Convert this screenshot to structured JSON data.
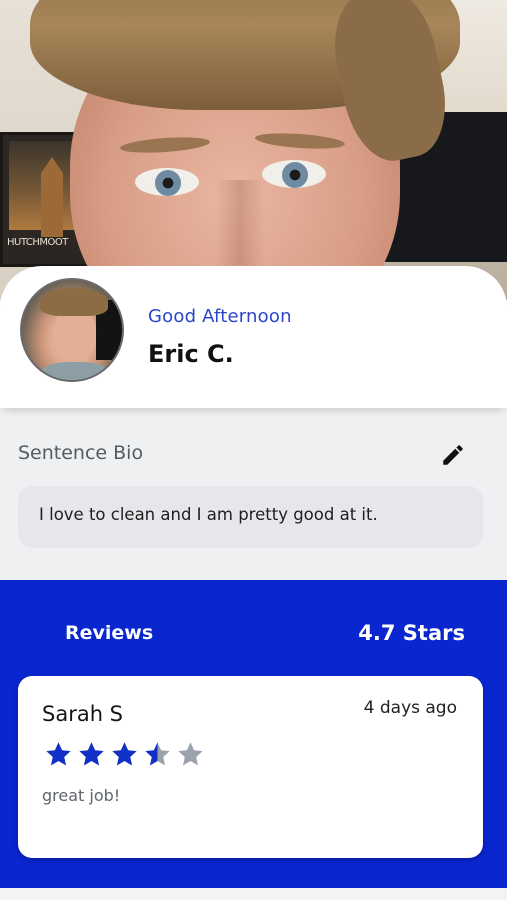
{
  "hero": {
    "image_alt": "Cover photo",
    "poster_text": "HUTCHMOOT"
  },
  "profile": {
    "greeting": "Good Afternoon",
    "name": "Eric C."
  },
  "bio": {
    "label": "Sentence Bio",
    "text": "I love to clean and I am pretty good at it.",
    "edit_icon": "pencil-icon"
  },
  "reviews": {
    "title": "Reviews",
    "rating_text": "4.7 Stars",
    "items": [
      {
        "reviewer": "Sarah S",
        "time": "4 days ago",
        "rating": 3.5,
        "max_rating": 5,
        "comment": "great job!"
      }
    ]
  },
  "colors": {
    "accent": "#2b45c9",
    "reviews_bg": "#0a26cf",
    "star_filled": "#1030c8",
    "star_empty": "#9aa2ad"
  }
}
